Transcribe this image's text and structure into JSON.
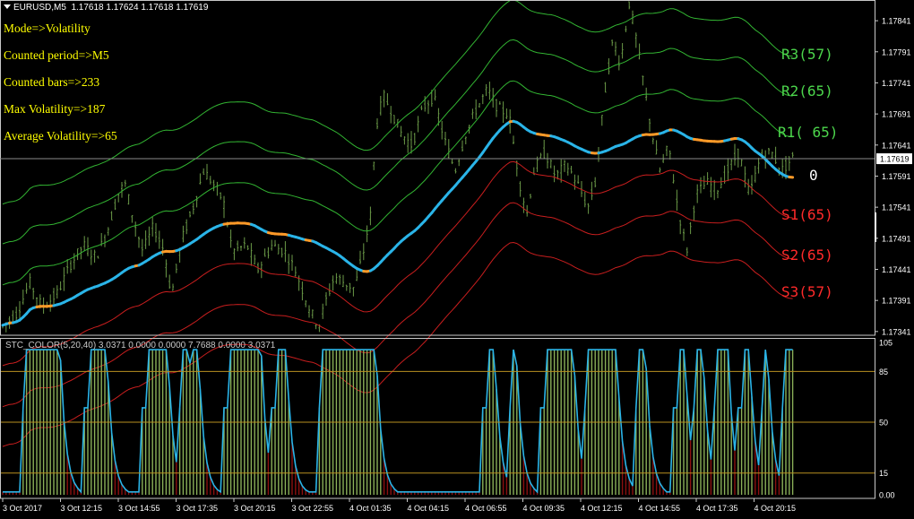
{
  "header": {
    "symbol": "EURUSD,M5",
    "ohlc": "1.17618 1.17624 1.17618 1.17619"
  },
  "info_panel": [
    "Mode=>Volatility",
    "Counted period=>M5",
    "Counted bars=>233",
    "Max Volatility=>187",
    "Average Volatility=>65"
  ],
  "levels": {
    "r3": "R3(57)",
    "r2": "R2(65)",
    "r1": "R1( 65)",
    "s1": "S1(65)",
    "s2": "S2(65)",
    "s3": "S3(57)",
    "zero": "0"
  },
  "colors": {
    "background": "#000000",
    "candles": "#6b9a48",
    "channel_green": "#32b432",
    "channel_red": "#c81e1e",
    "ma_up": "#2ab4e8",
    "ma_flat": "#ff9a28",
    "level_green": "#4cd64c",
    "level_red": "#ff2a2a",
    "stc_line": "#2ab4e8",
    "stc_hist_up": "#8ab058",
    "stc_hist_down": "#8a1010",
    "stc_levels": "#b89020",
    "price_label_bg": "#ffffff"
  },
  "chart_data": [
    {
      "type": "candlestick",
      "symbol": "EURUSD",
      "timeframe": "M5",
      "price_axis_ticks": [
        "1.17841",
        "1.17791",
        "1.17741",
        "1.17691",
        "1.17641",
        "1.17591",
        "1.17541",
        "1.17491",
        "1.17441",
        "1.17391",
        "1.17341"
      ],
      "ylim": [
        1.17335,
        1.1787
      ],
      "current_price": "1.17619",
      "time_axis_ticks": [
        "3 Oct 2017",
        "3 Oct 12:15",
        "3 Oct 14:55",
        "3 Oct 17:35",
        "3 Oct 20:15",
        "3 Oct 22:55",
        "4 Oct 01:35",
        "4 Oct 04:15",
        "4 Oct 06:55",
        "4 Oct 09:35",
        "4 Oct 12:15",
        "4 Oct 14:55",
        "4 Oct 17:35",
        "4 Oct 20:15"
      ],
      "bars_shown": 233,
      "price_path": [
        [
          0,
          1.1735
        ],
        [
          8,
          1.1737
        ],
        [
          15,
          1.1742
        ],
        [
          22,
          1.1738
        ],
        [
          30,
          1.174
        ],
        [
          38,
          1.1745
        ],
        [
          45,
          1.1748
        ],
        [
          52,
          1.1746
        ],
        [
          58,
          1.175
        ],
        [
          64,
          1.1756
        ],
        [
          68,
          1.1758
        ],
        [
          73,
          1.1752
        ],
        [
          78,
          1.1747
        ],
        [
          84,
          1.1751
        ],
        [
          90,
          1.1747
        ],
        [
          94,
          1.174
        ],
        [
          100,
          1.1749
        ],
        [
          106,
          1.1754
        ],
        [
          112,
          1.176
        ],
        [
          117,
          1.1758
        ],
        [
          123,
          1.1755
        ],
        [
          128,
          1.1747
        ],
        [
          136,
          1.1748
        ],
        [
          142,
          1.1744
        ],
        [
          150,
          1.1748
        ],
        [
          157,
          1.1747
        ],
        [
          163,
          1.1744
        ],
        [
          168,
          1.174
        ],
        [
          172,
          1.1737
        ],
        [
          176,
          1.1735
        ],
        [
          180,
          1.1739
        ],
        [
          185,
          1.1743
        ],
        [
          190,
          1.1742
        ],
        [
          196,
          1.1741
        ],
        [
          201,
          1.1747
        ],
        [
          205,
          1.1753
        ],
        [
          208,
          1.1767
        ],
        [
          212,
          1.1772
        ],
        [
          216,
          1.177
        ],
        [
          222,
          1.1766
        ],
        [
          228,
          1.1764
        ],
        [
          234,
          1.177
        ],
        [
          240,
          1.1772
        ],
        [
          246,
          1.1765
        ],
        [
          252,
          1.176
        ],
        [
          258,
          1.1766
        ],
        [
          264,
          1.177
        ],
        [
          270,
          1.1773
        ],
        [
          276,
          1.177
        ],
        [
          282,
          1.1769
        ],
        [
          288,
          1.1758
        ],
        [
          292,
          1.1753
        ],
        [
          296,
          1.176
        ],
        [
          302,
          1.1763
        ],
        [
          308,
          1.1759
        ],
        [
          314,
          1.1761
        ],
        [
          320,
          1.1758
        ],
        [
          326,
          1.1754
        ],
        [
          330,
          1.1758
        ],
        [
          336,
          1.1774
        ],
        [
          340,
          1.1781
        ],
        [
          344,
          1.1777
        ],
        [
          349,
          1.1787
        ],
        [
          353,
          1.1781
        ],
        [
          357,
          1.1774
        ],
        [
          361,
          1.1767
        ],
        [
          366,
          1.176
        ],
        [
          371,
          1.1764
        ],
        [
          376,
          1.1754
        ],
        [
          381,
          1.1747
        ],
        [
          386,
          1.1756
        ],
        [
          392,
          1.1758
        ],
        [
          398,
          1.1757
        ],
        [
          404,
          1.176
        ],
        [
          410,
          1.1763
        ],
        [
          416,
          1.1756
        ],
        [
          422,
          1.1762
        ],
        [
          428,
          1.1763
        ],
        [
          434,
          1.176
        ],
        [
          440,
          1.1762
        ]
      ],
      "overlays": [
        {
          "name": "R3(57)",
          "color": "green"
        },
        {
          "name": "R2(65)",
          "color": "green"
        },
        {
          "name": "R1( 65)",
          "color": "green"
        },
        {
          "name": "S1(65)",
          "color": "red"
        },
        {
          "name": "S2(65)",
          "color": "red"
        },
        {
          "name": "S3(57)",
          "color": "red"
        },
        {
          "name": "0",
          "color": "blue/orange"
        }
      ]
    },
    {
      "type": "area",
      "title": "STC_COLOR(5,20,40) 3.0371 0.0000 0.0000 7.7688 0.0000 3.0371",
      "ylim": [
        0,
        105
      ],
      "y_ticks": [
        "105",
        "85",
        "50",
        "15",
        "0.00"
      ],
      "levels": [
        85,
        50,
        15
      ],
      "peak_intervals": [
        [
          13,
          32
        ],
        [
          48,
          58
        ],
        [
          80,
          92
        ],
        [
          100,
          104
        ],
        [
          106,
          109
        ],
        [
          126,
          144
        ],
        [
          152,
          158
        ],
        [
          178,
          208
        ],
        [
          270,
          274
        ],
        [
          284,
          286
        ],
        [
          302,
          318
        ],
        [
          326,
          342
        ],
        [
          354,
          358
        ],
        [
          376,
          380
        ],
        [
          386,
          390
        ],
        [
          398,
          404
        ],
        [
          412,
          416
        ],
        [
          424,
          426
        ],
        [
          436,
          440
        ]
      ]
    }
  ]
}
